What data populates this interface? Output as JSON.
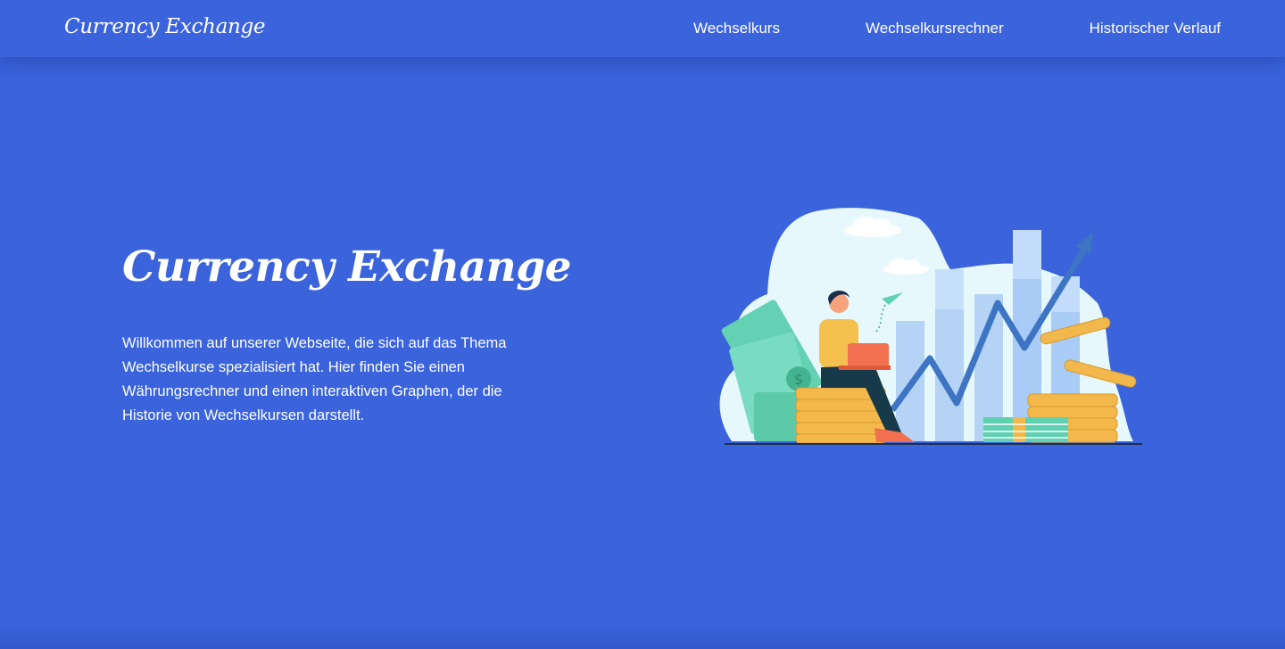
{
  "header": {
    "brand": "Currency Exchange",
    "nav": [
      {
        "label": "Wechselkurs"
      },
      {
        "label": "Wechselkursrechner"
      },
      {
        "label": "Historischer Verlauf"
      }
    ]
  },
  "hero": {
    "title": "Currency Exchange",
    "description": "Willkommen auf unserer Webseite, die sich auf das Thema Wechselkurse spezialisiert hat. Hier finden Sie einen Währungsrechner und einen interaktiven Graphen, der die Historie von Wechselkursen darstellt.",
    "illustration": "finance-growth-illustration"
  },
  "colors": {
    "background": "#3a63dc",
    "text": "#ffffff",
    "accent_coin": "#f2b84b",
    "accent_money": "#5fd0b0",
    "accent_arrow": "#3e78c8"
  }
}
